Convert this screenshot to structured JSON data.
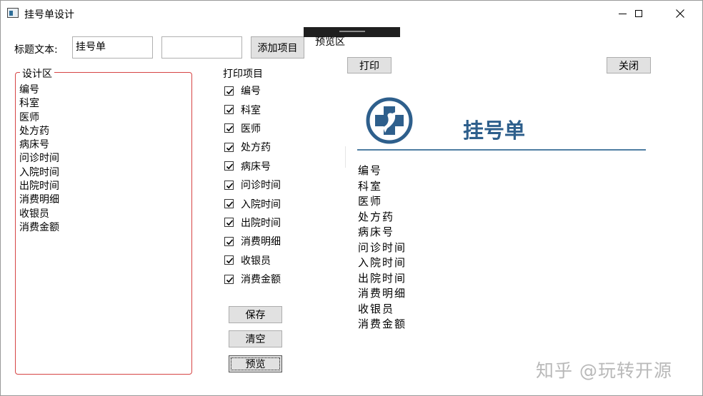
{
  "window": {
    "title": "挂号单设计"
  },
  "form": {
    "title_label": "标题文本:",
    "title_value": "挂号单",
    "item_value": "",
    "add_button": "添加项目"
  },
  "design": {
    "group_label": "设计区",
    "items": [
      "编号",
      "科室",
      "医师",
      "处方药",
      "病床号",
      "问诊时间",
      "入院时间",
      "出院时间",
      "消费明细",
      "收银员",
      "消费金额"
    ]
  },
  "print_items": {
    "label": "打印项目",
    "items": [
      {
        "label": "编号",
        "checked": true
      },
      {
        "label": "科室",
        "checked": true
      },
      {
        "label": "医师",
        "checked": true
      },
      {
        "label": "处方药",
        "checked": true
      },
      {
        "label": "病床号",
        "checked": true
      },
      {
        "label": "问诊时间",
        "checked": true
      },
      {
        "label": "入院时间",
        "checked": true
      },
      {
        "label": "出院时间",
        "checked": true
      },
      {
        "label": "消费明细",
        "checked": true
      },
      {
        "label": "收银员",
        "checked": true
      },
      {
        "label": "消费金额",
        "checked": true
      }
    ]
  },
  "actions": {
    "save": "保存",
    "clear": "清空",
    "preview": "预览"
  },
  "preview": {
    "area_label": "预览区",
    "print_button": "打印",
    "close_button": "关闭",
    "logo_icon": "hospital-cross-logo-icon",
    "heading": "挂号单",
    "items": [
      "编号",
      "科室",
      "医师",
      "处方药",
      "病床号",
      "问诊时间",
      "入院时间",
      "出院时间",
      "消费明细",
      "收银员",
      "消费金额"
    ]
  },
  "watermark": "知乎 @玩转开源",
  "colors": {
    "accent_blue": "#2e5f8c",
    "group_border": "#d64545"
  }
}
